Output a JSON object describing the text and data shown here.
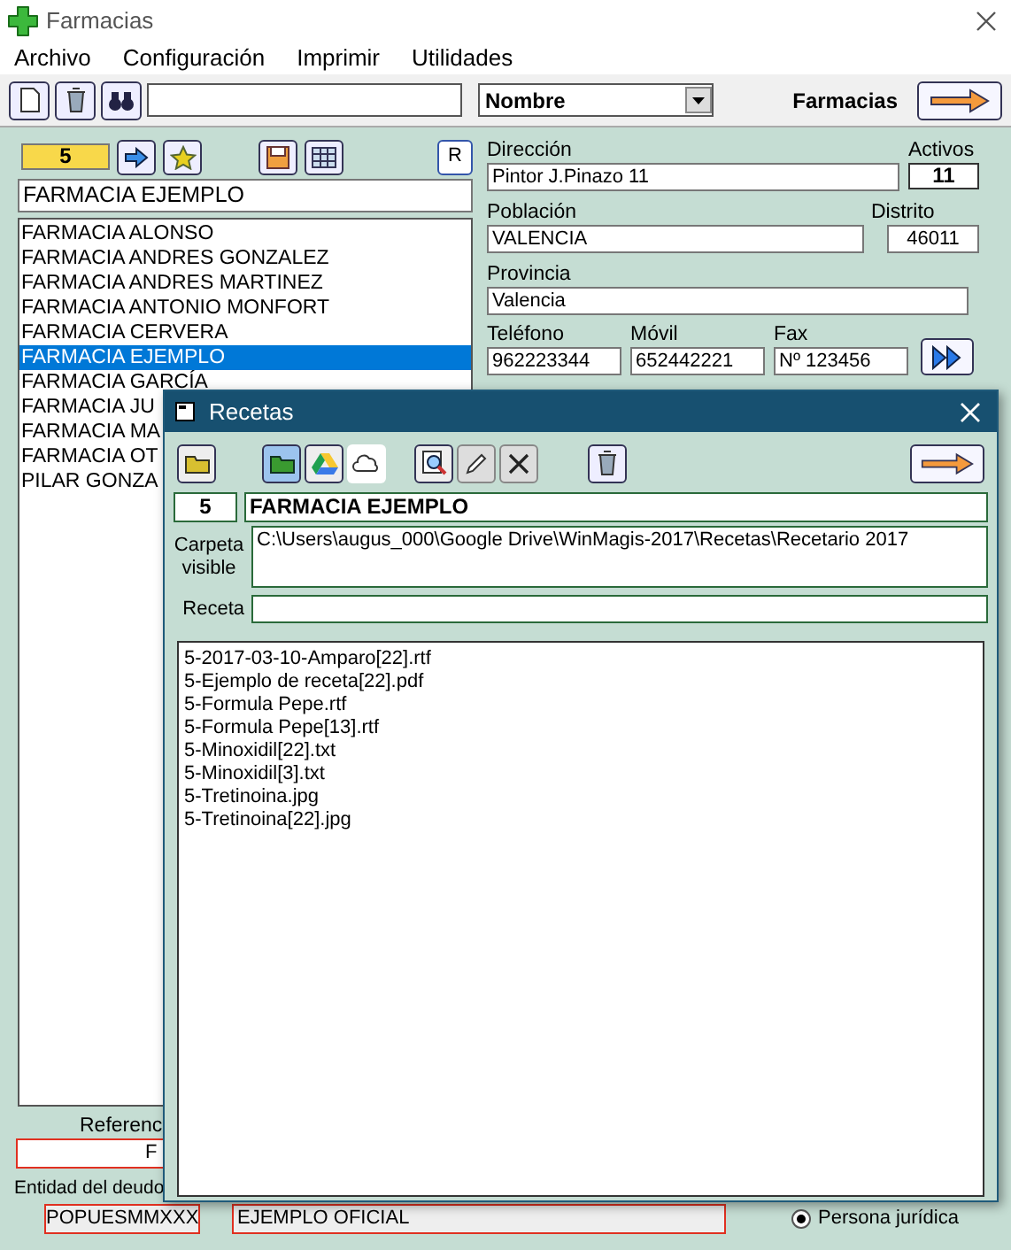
{
  "window": {
    "title": "Farmacias"
  },
  "menu": [
    "Archivo",
    "Configuración",
    "Imprimir",
    "Utilidades"
  ],
  "toolbar": {
    "sort_field": "Nombre",
    "section_label": "Farmacias"
  },
  "record": {
    "number": "5",
    "name": "FARMACIA EJEMPLO",
    "r_button": "R"
  },
  "pharmacies": [
    {
      "label": "FARMACIA ALONSO",
      "selected": false
    },
    {
      "label": "FARMACIA ANDRES GONZALEZ",
      "selected": false
    },
    {
      "label": "FARMACIA ANDRES MARTINEZ",
      "selected": false
    },
    {
      "label": "FARMACIA ANTONIO MONFORT",
      "selected": false
    },
    {
      "label": "FARMACIA CERVERA",
      "selected": false
    },
    {
      "label": "FARMACIA EJEMPLO",
      "selected": true
    },
    {
      "label": "FARMACIA GARCÍA",
      "selected": false
    },
    {
      "label": "FARMACIA JU",
      "selected": false
    },
    {
      "label": "FARMACIA MA",
      "selected": false
    },
    {
      "label": "FARMACIA OT",
      "selected": false
    },
    {
      "label": "PILAR GONZA",
      "selected": false
    }
  ],
  "details": {
    "direccion": {
      "label": "Dirección",
      "value": "Pintor J.Pinazo 11"
    },
    "activos": {
      "label": "Activos",
      "value": "11"
    },
    "poblacion": {
      "label": "Población",
      "value": "VALENCIA"
    },
    "distrito": {
      "label": "Distrito",
      "value": "46011"
    },
    "provincia": {
      "label": "Provincia",
      "value": "Valencia"
    },
    "telefono": {
      "label": "Teléfono",
      "value": "962223344"
    },
    "movil": {
      "label": "Móvil",
      "value": "652442221"
    },
    "fax": {
      "label": "Fax",
      "value": "Nº 123456"
    }
  },
  "bottom": {
    "reference_label": "Referenc",
    "reference_value": "F",
    "debtor_label": "Entidad del deudo",
    "bic": "POPUESMMXXX",
    "entity": "EJEMPLO OFICIAL",
    "radio": {
      "label": "Persona jurídica",
      "selected": true
    }
  },
  "dialog": {
    "title": "Recetas",
    "number": "5",
    "name": "FARMACIA EJEMPLO",
    "folder_label": "Carpeta visible",
    "folder_value": "C:\\Users\\augus_000\\Google Drive\\WinMagis-2017\\Recetas\\Recetario 2017",
    "recipe_label": "Receta",
    "files": [
      "5-2017-03-10-Amparo[22].rtf",
      "5-Ejemplo de receta[22].pdf",
      "5-Formula Pepe.rtf",
      "5-Formula Pepe[13].rtf",
      "5-Minoxidil[22].txt",
      "5-Minoxidil[3].txt",
      "5-Tretinoina.jpg",
      "5-Tretinoina[22].jpg"
    ]
  }
}
